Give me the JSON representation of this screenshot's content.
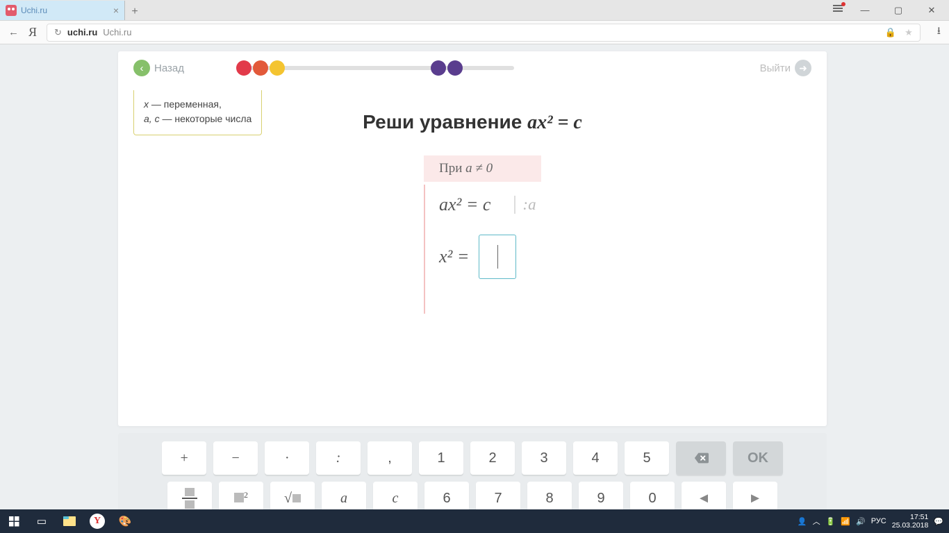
{
  "browser": {
    "tab_title": "Uchi.ru",
    "url_domain": "uchi.ru",
    "url_path": "Uchi.ru"
  },
  "card": {
    "back_label": "Назад",
    "exit_label": "Выйти",
    "progress": {
      "dots": [
        {
          "color": "#e23a4a",
          "pos": 0
        },
        {
          "color": "#e2593a",
          "pos": 24
        },
        {
          "color": "#f4c430",
          "pos": 48
        },
        {
          "color": "#5a3d8e",
          "pos": 280
        },
        {
          "color": "#5a3d8e",
          "pos": 304
        }
      ]
    }
  },
  "note": {
    "line1_var": "x",
    "line1_text": " — переменная,",
    "line2_vars": "a, c",
    "line2_text": " — некоторые числа"
  },
  "task": {
    "title_prefix": "Реши уравнение ",
    "title_eq": "ax² = c",
    "condition_prefix": "При ",
    "condition_expr": "a ≠ 0",
    "step1_left": "ax² = c",
    "step1_op": ":a",
    "step2_left": "x² =",
    "input_value": ""
  },
  "keyboard": {
    "row1": [
      "+",
      "−",
      "·",
      ":",
      ",",
      "1",
      "2",
      "3",
      "4",
      "5"
    ],
    "row1_special": {
      "backspace": "bksp",
      "ok": "OK"
    },
    "row2": [
      "frac",
      "□²",
      "√□",
      "a",
      "c",
      "6",
      "7",
      "8",
      "9",
      "0",
      "◄",
      "►"
    ]
  },
  "taskbar": {
    "time": "17:51",
    "date": "25.03.2018",
    "lang": "РУС"
  }
}
